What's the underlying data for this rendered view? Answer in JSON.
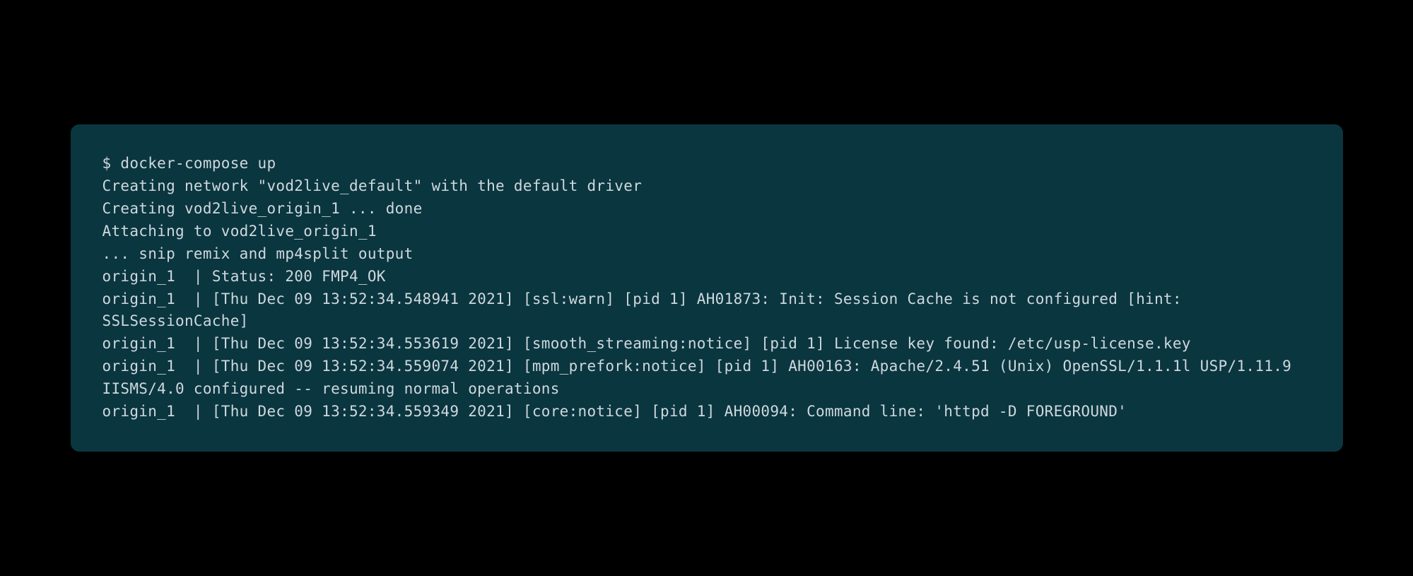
{
  "terminal": {
    "prompt": "$ ",
    "command": "docker-compose up",
    "lines": [
      "Creating network \"vod2live_default\" with the default driver",
      "Creating vod2live_origin_1 ... done",
      "Attaching to vod2live_origin_1",
      "... snip remix and mp4split output",
      "origin_1  | Status: 200 FMP4_OK",
      "origin_1  | [Thu Dec 09 13:52:34.548941 2021] [ssl:warn] [pid 1] AH01873: Init: Session Cache is not configured [hint: SSLSessionCache]",
      "origin_1  | [Thu Dec 09 13:52:34.553619 2021] [smooth_streaming:notice] [pid 1] License key found: /etc/usp-license.key",
      "origin_1  | [Thu Dec 09 13:52:34.559074 2021] [mpm_prefork:notice] [pid 1] AH00163: Apache/2.4.51 (Unix) OpenSSL/1.1.1l USP/1.11.9 IISMS/4.0 configured -- resuming normal operations",
      "origin_1  | [Thu Dec 09 13:52:34.559349 2021] [core:notice] [pid 1] AH00094: Command line: 'httpd -D FOREGROUND'"
    ]
  },
  "colors": {
    "background": "#000000",
    "terminal_bg": "#0a3640",
    "text": "#cfd8dc"
  }
}
